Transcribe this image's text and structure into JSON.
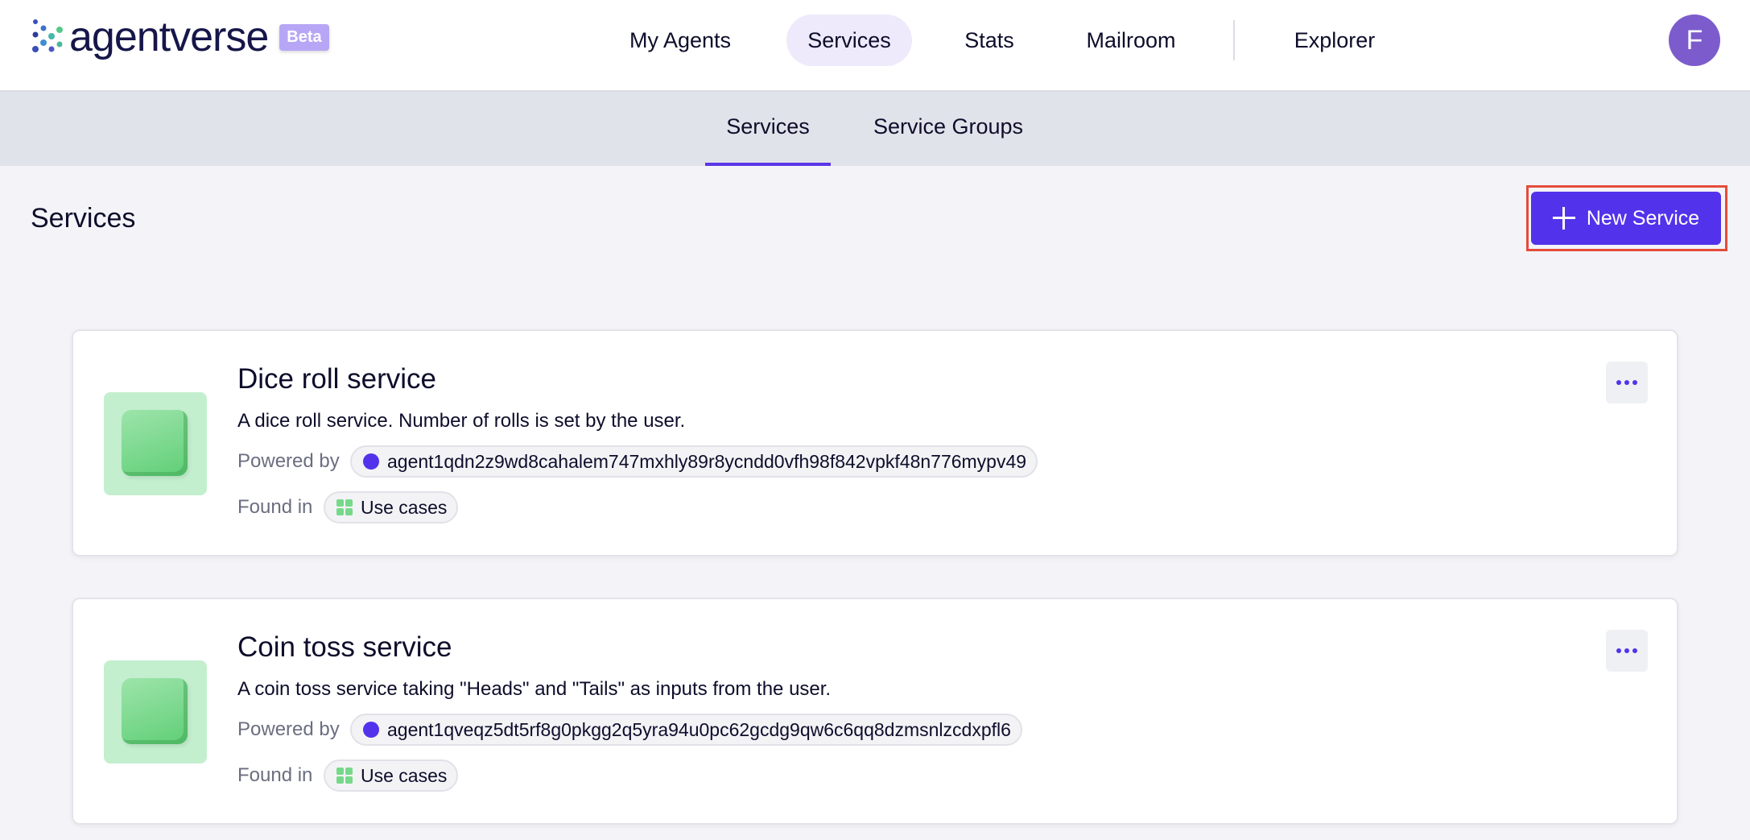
{
  "brand": {
    "name": "agentverse",
    "badge": "Beta"
  },
  "nav": {
    "items": [
      {
        "label": "My Agents"
      },
      {
        "label": "Services",
        "active": true
      },
      {
        "label": "Stats"
      },
      {
        "label": "Mailroom"
      },
      {
        "label": "Explorer"
      }
    ]
  },
  "user": {
    "initial": "F"
  },
  "subnav": {
    "tabs": [
      {
        "label": "Services",
        "active": true
      },
      {
        "label": "Service Groups"
      }
    ]
  },
  "page": {
    "title": "Services",
    "new_button_label": "New Service"
  },
  "services": [
    {
      "title": "Dice roll service",
      "description": "A dice roll service. Number of rolls is set by the user.",
      "powered_by_label": "Powered by",
      "agent": "agent1qdn2z9wd8cahalem747mxhly89r8ycndd0vfh98f842vpkf48n776mypv49",
      "found_in_label": "Found in",
      "group": "Use cases"
    },
    {
      "title": "Coin toss service",
      "description": "A coin toss service taking \"Heads\" and \"Tails\" as inputs from the user.",
      "powered_by_label": "Powered by",
      "agent": "agent1qveqz5dt5rf8g0pkgg2q5yra94u0pc62gcdg9qw6c6qq8dzmsnlzcdxpfl6",
      "found_in_label": "Found in",
      "group": "Use cases"
    }
  ],
  "colors": {
    "accent": "#5233eb",
    "avatar": "#7c5ccc",
    "highlight_outline": "#e54b3a",
    "thumb": "#c3efcf"
  }
}
